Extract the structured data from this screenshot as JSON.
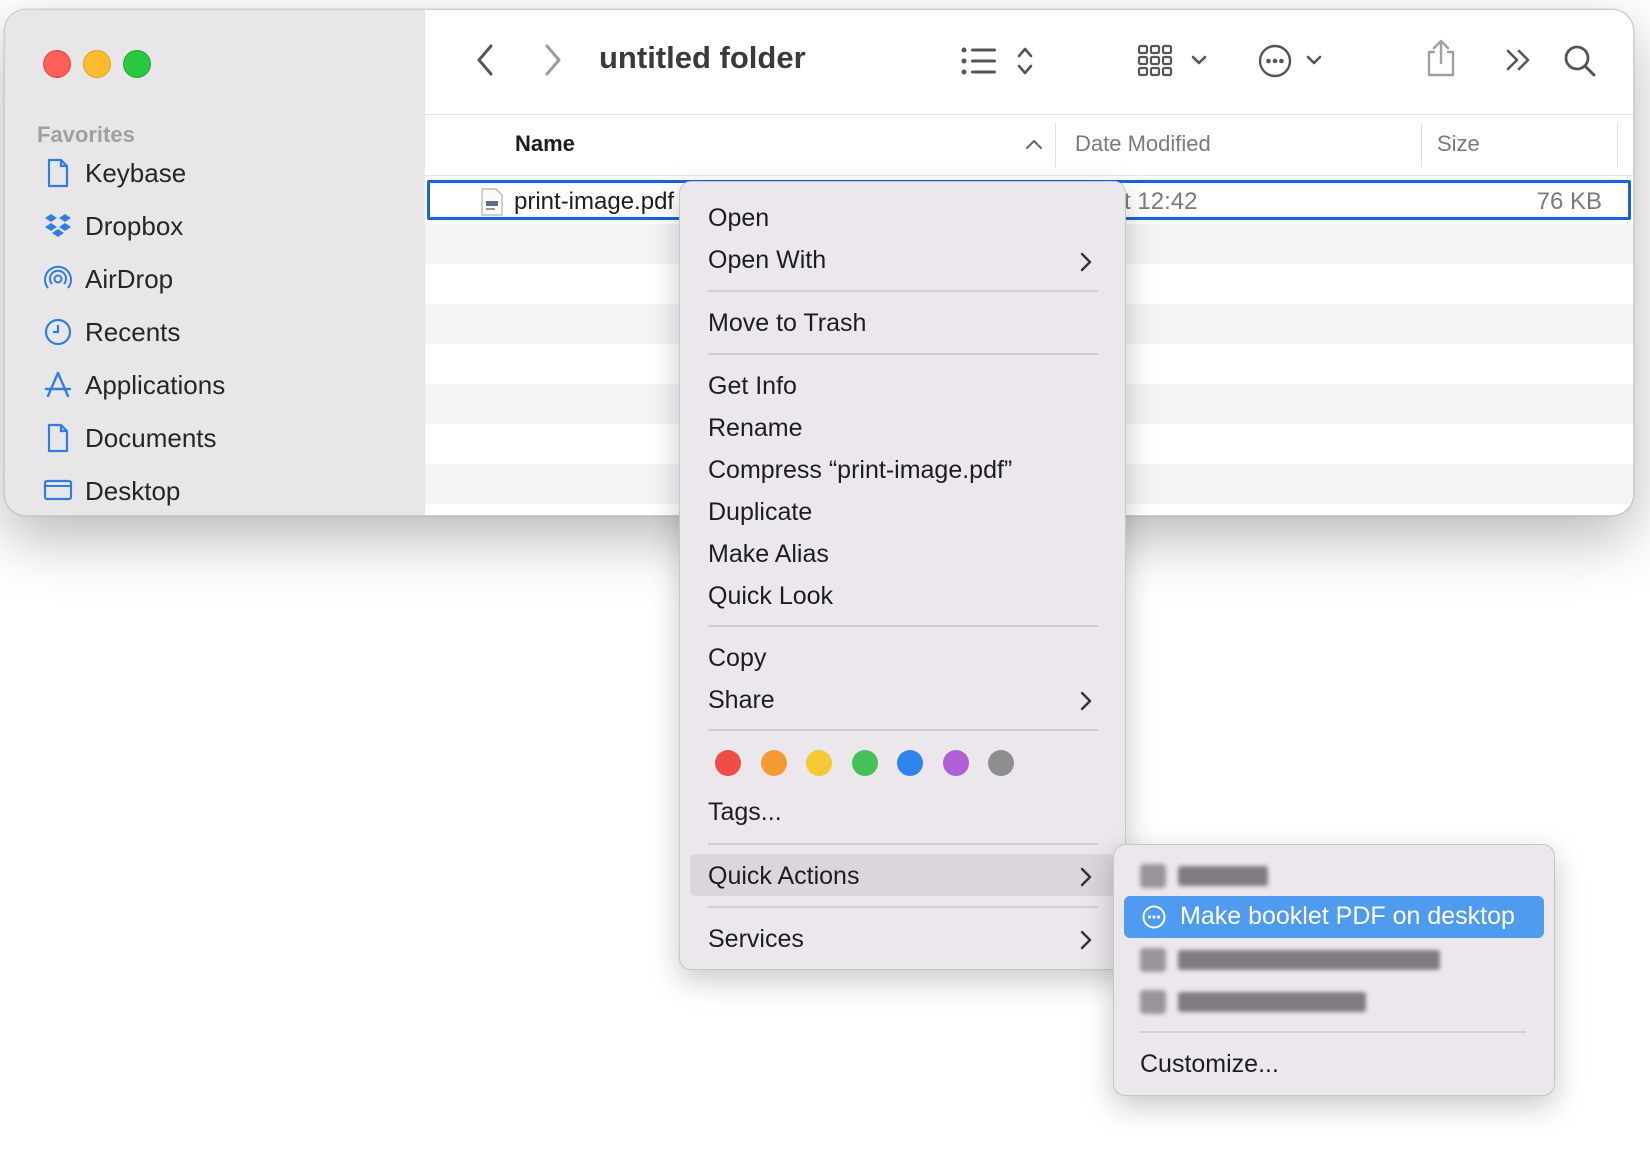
{
  "window": {
    "title": "untitled folder"
  },
  "sidebar": {
    "heading": "Favorites",
    "items": [
      {
        "label": "Keybase",
        "icon": "document-icon"
      },
      {
        "label": "Dropbox",
        "icon": "dropbox-icon"
      },
      {
        "label": "AirDrop",
        "icon": "airdrop-icon"
      },
      {
        "label": "Recents",
        "icon": "clock-icon"
      },
      {
        "label": "Applications",
        "icon": "applications-icon"
      },
      {
        "label": "Documents",
        "icon": "document-icon"
      },
      {
        "label": "Desktop",
        "icon": "desktop-icon"
      }
    ]
  },
  "columns": {
    "name": "Name",
    "date_modified": "Date Modified",
    "size": "Size"
  },
  "file": {
    "name": "print-image.pdf",
    "date": "Today at 12:42",
    "size": "76 KB"
  },
  "context_menu": {
    "open": "Open",
    "open_with": "Open With",
    "move_to_trash": "Move to Trash",
    "get_info": "Get Info",
    "rename": "Rename",
    "compress": "Compress “print-image.pdf”",
    "duplicate": "Duplicate",
    "make_alias": "Make Alias",
    "quick_look": "Quick Look",
    "copy": "Copy",
    "share": "Share",
    "tags": "Tags...",
    "quick_actions": "Quick Actions",
    "services": "Services"
  },
  "tag_colors": [
    "#ee4c45",
    "#f39a33",
    "#f5c933",
    "#47c157",
    "#2f84ec",
    "#b05fd4",
    "#8e8e91"
  ],
  "quick_actions_submenu": {
    "highlighted": "Make booklet PDF on desktop",
    "customize": "Customize..."
  },
  "colors": {
    "selection_border": "#1565d8",
    "menu_highlight": "#4f9bf0",
    "menu_background": "#ece7ec",
    "sidebar_background": "#e9e6e9",
    "sidebar_icon": "#2f7de1"
  }
}
